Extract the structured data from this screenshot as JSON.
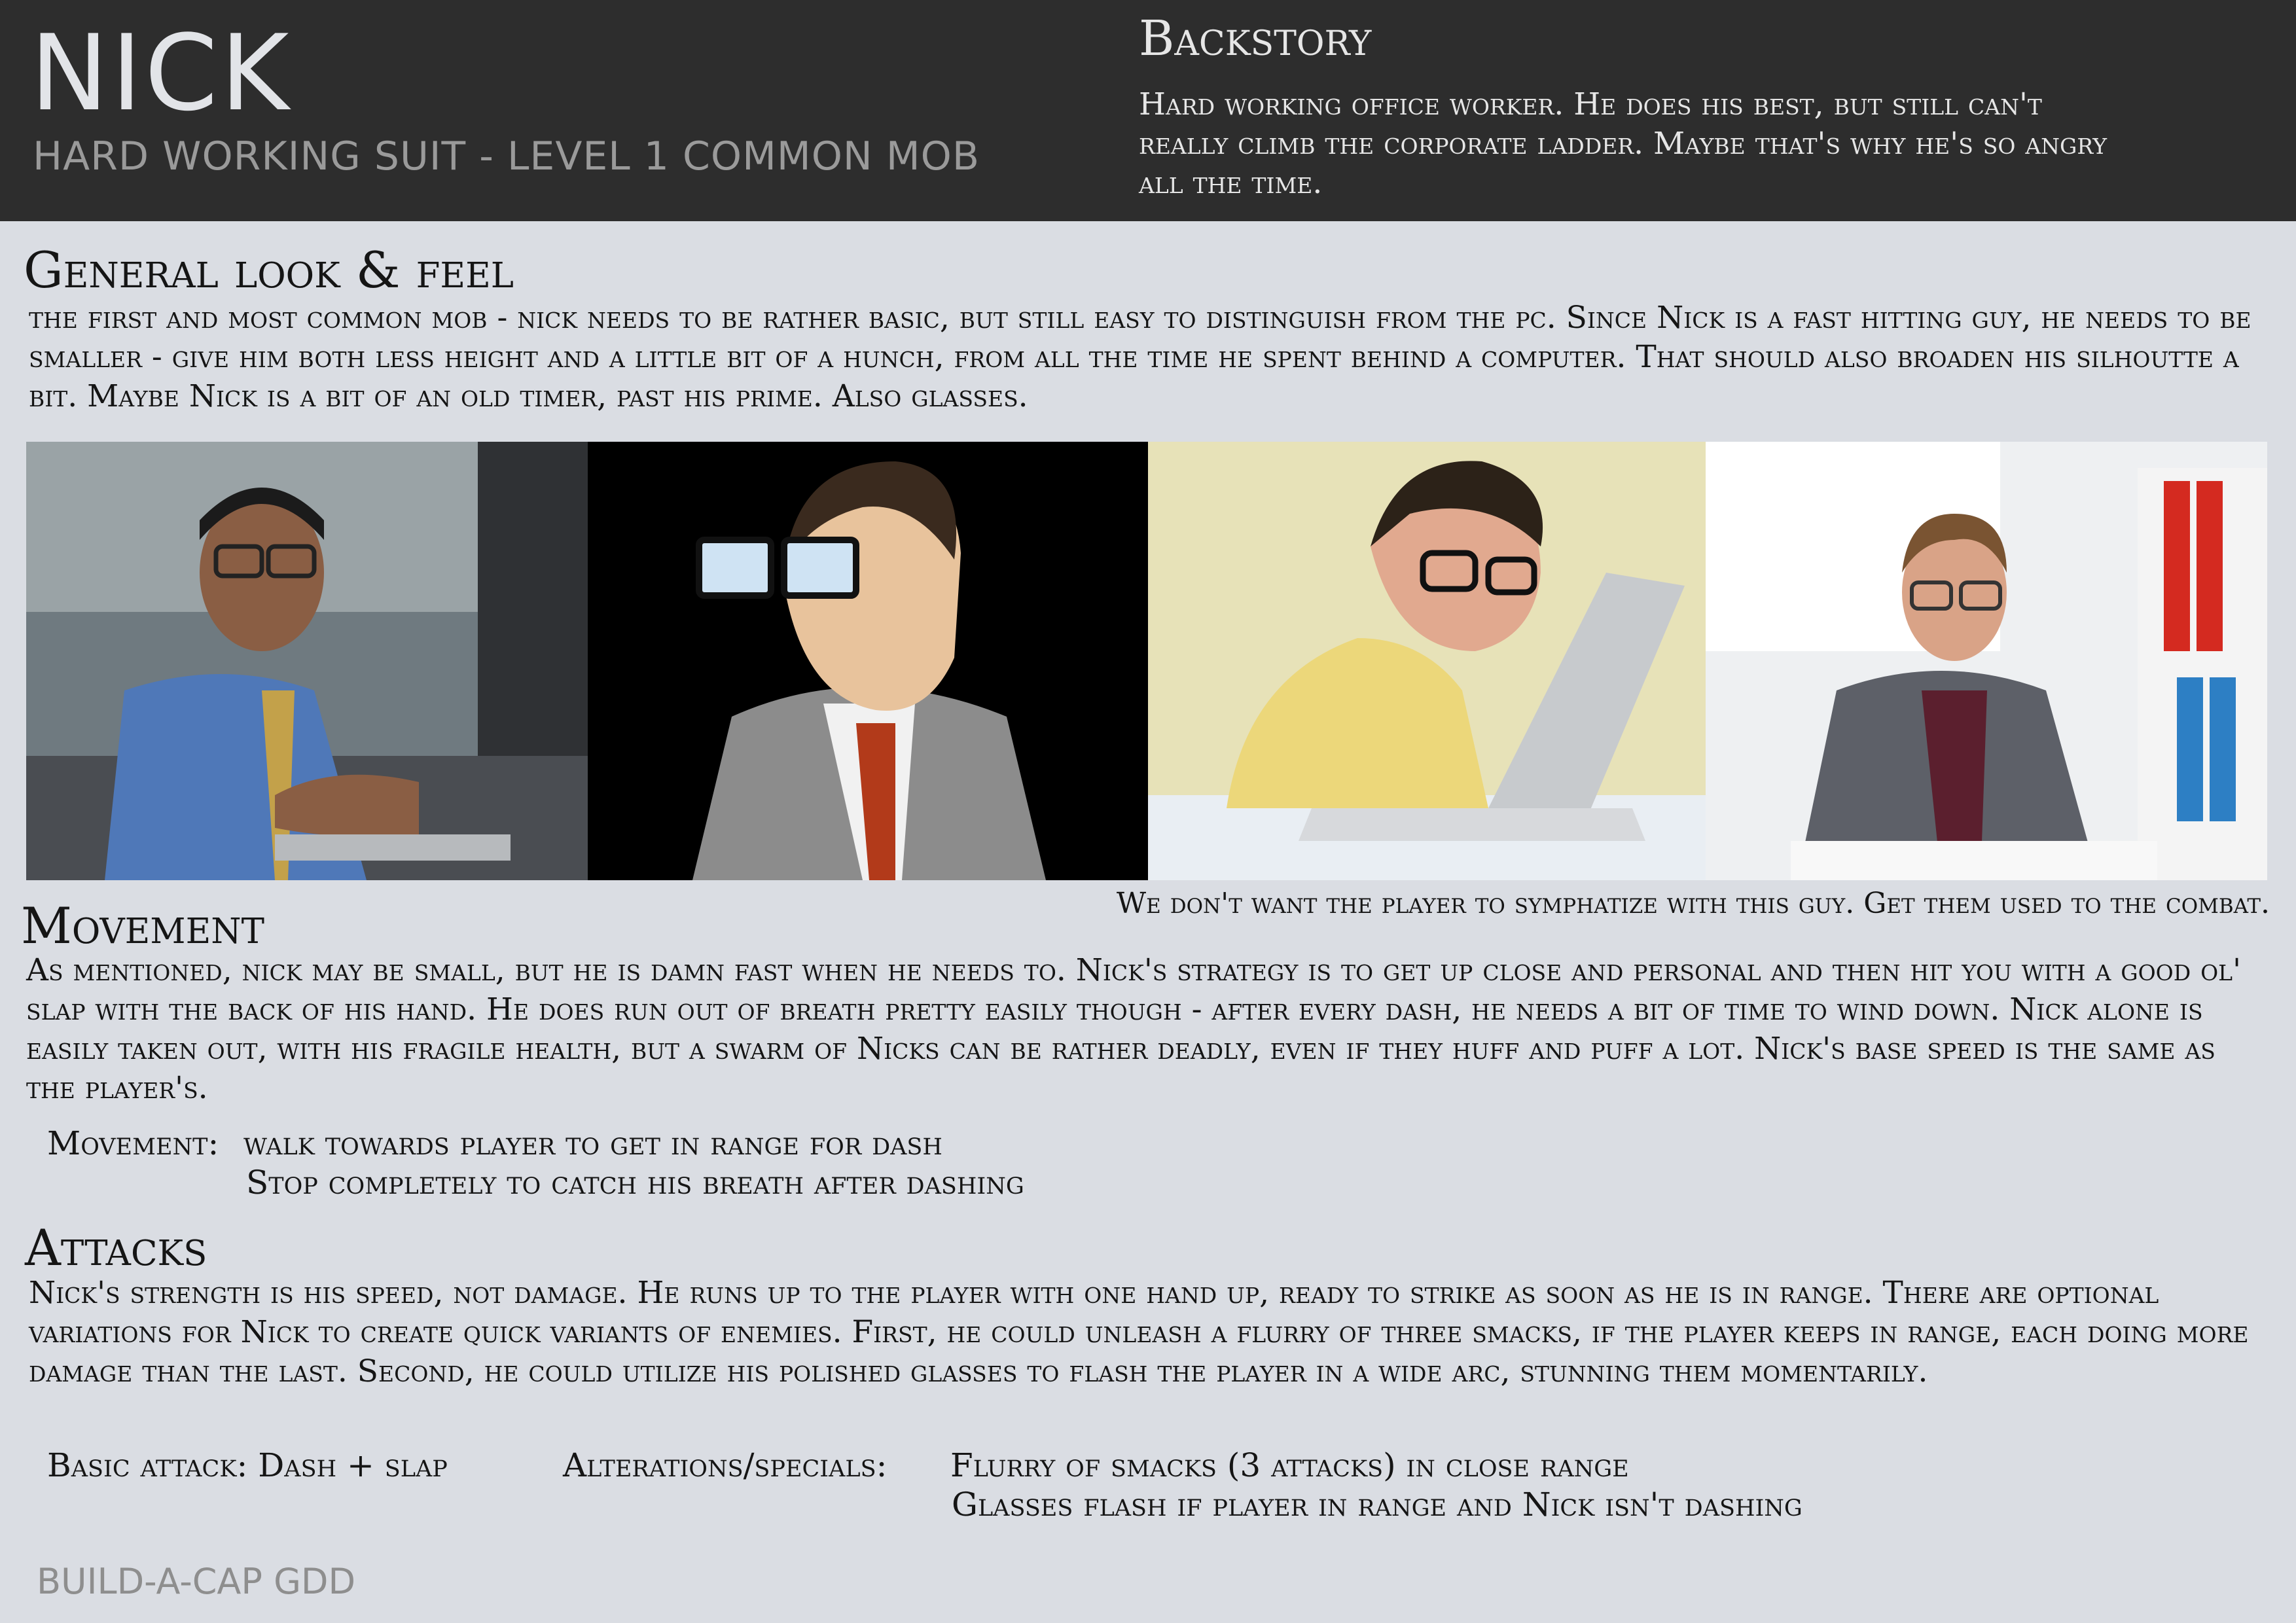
{
  "header": {
    "name": "NICK",
    "subtitle": "HARD WORKING SUIT - LEVEL 1 COMMON MOB",
    "backstory_heading": "Backstory",
    "backstory_text": "Hard working office worker. He does his best, but still can't really climb the corporate ladder. Maybe that's why he's so angry all the time."
  },
  "look": {
    "heading": "General look & feel",
    "text": "the first and most common mob - nick needs to be rather basic, but still easy to distinguish from the pc. Since Nick is a fast hitting guy, he needs to be smaller - give him both less height and a little bit of a hunch, from all the time he spent behind a computer. That should also broaden his silhoutte a bit. Maybe Nick is a bit of an old timer, past his prime. Also glasses."
  },
  "images": {
    "caption": "We don't want the player to symphatize with this guy. Get them used to the combat."
  },
  "movement": {
    "heading": "Movement",
    "text": "As mentioned, nick may be small, but he is damn fast when he needs to. Nick's strategy is to get up close and personal and then hit you with a good ol' slap with the back of his hand. He does run out of breath pretty easily though - after every dash, he needs a bit of time to wind down. Nick alone is easily taken out, with his fragile health, but a swarm of Nicks can be rather deadly, even if they huff and puff a lot. Nick's base speed is the same as the player's.",
    "spec_label": "Movement:",
    "spec_line1": "walk towards player to get in range for dash",
    "spec_line2": "Stop completely to catch his breath after dashing"
  },
  "attacks": {
    "heading": "Attacks",
    "text": "Nick's strength is his speed, not damage. He runs up to the player with one hand up, ready to strike as soon as he is in range. There are optional variations for Nick to create quick variants of enemies. First, he could unleash a flurry of three smacks, if the player keeps in range, each doing more damage than the last. Second, he could utilize his polished glasses to flash the player in a wide arc, stunning them momentarily.",
    "basic": "Basic attack: Dash + slap",
    "alt_label": "Alterations/specials:",
    "alt_line1": "Flurry of smacks (3 attacks) in close range",
    "alt_line2": "Glasses flash if player in range and Nick isn't dashing"
  },
  "footer": {
    "text": "BUILD-A-CAP GDD"
  }
}
